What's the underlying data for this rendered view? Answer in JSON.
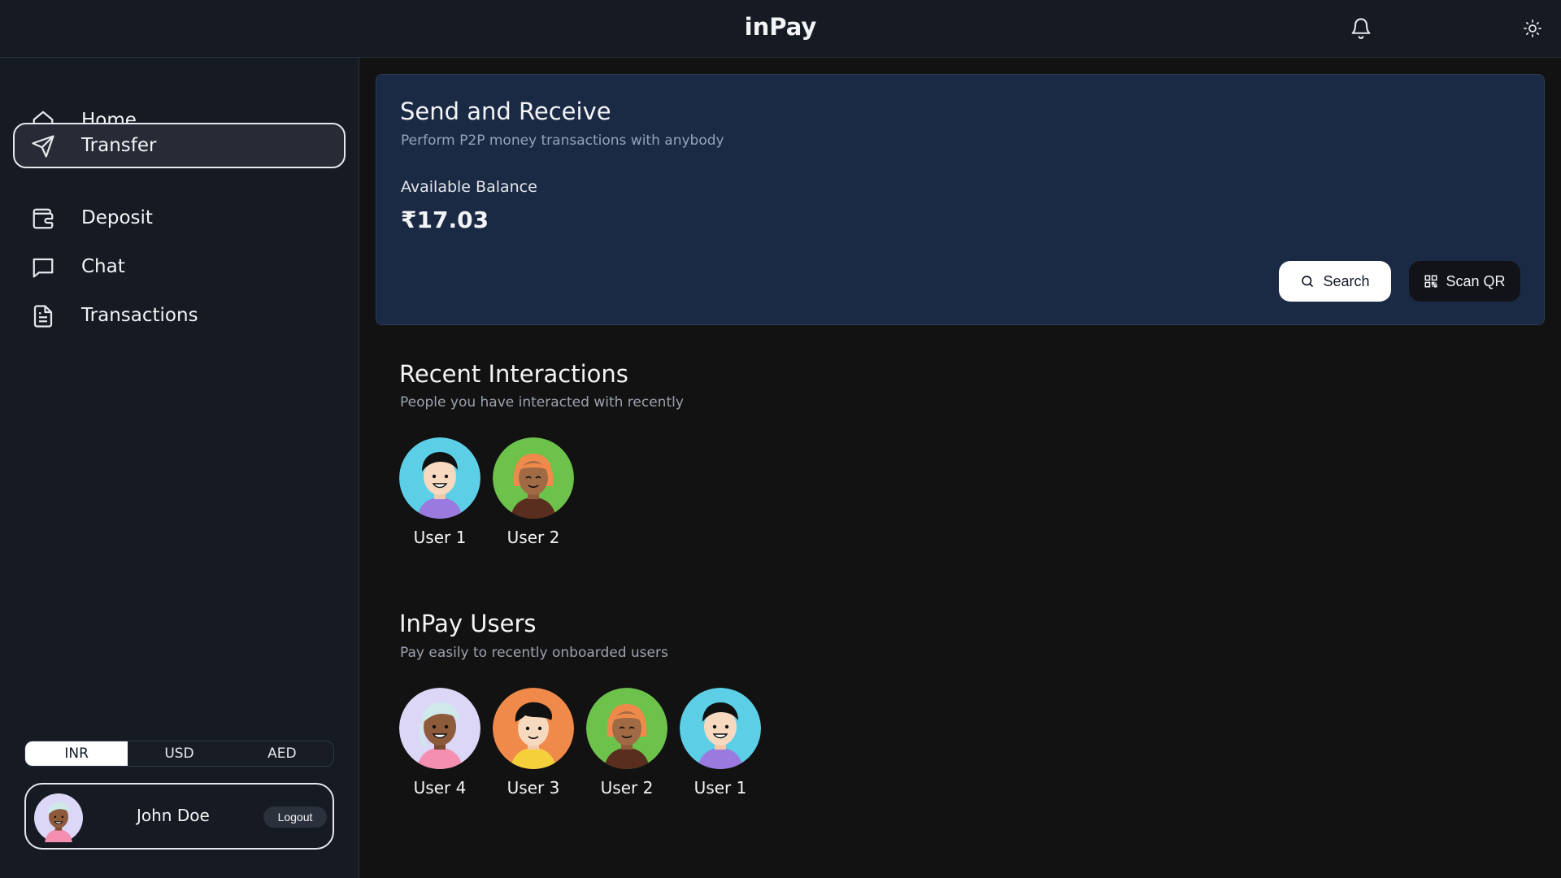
{
  "app": {
    "title": "inPay"
  },
  "header": {
    "bell_icon": "bell-icon",
    "theme_icon": "sun-icon"
  },
  "sidebar": {
    "items": [
      {
        "label": "Home",
        "icon": "home-icon",
        "active": false
      },
      {
        "label": "Transfer",
        "icon": "send-icon",
        "active": true
      },
      {
        "label": "Deposit",
        "icon": "wallet-icon",
        "active": false
      },
      {
        "label": "Chat",
        "icon": "chat-icon",
        "active": false
      },
      {
        "label": "Transactions",
        "icon": "document-icon",
        "active": false
      }
    ],
    "currencies": [
      {
        "label": "INR",
        "selected": true
      },
      {
        "label": "USD",
        "selected": false
      },
      {
        "label": "AED",
        "selected": false
      }
    ],
    "user": {
      "name": "John Doe",
      "logout_label": "Logout"
    }
  },
  "hero": {
    "title": "Send and Receive",
    "subtitle": "Perform P2P money transactions with anybody",
    "balance_label": "Available Balance",
    "balance_value": "₹17.03",
    "search_label": "Search",
    "scan_label": "Scan QR"
  },
  "recent": {
    "title": "Recent Interactions",
    "subtitle": "People you have interacted with recently",
    "users": [
      {
        "name": "User 1",
        "bg": "#5ccfe6"
      },
      {
        "name": "User 2",
        "bg": "#6cc24a"
      }
    ]
  },
  "inpay_users": {
    "title": "InPay Users",
    "subtitle": "Pay easily to recently onboarded users",
    "users": [
      {
        "name": "User 4",
        "bg": "#dcd6f7"
      },
      {
        "name": "User 3",
        "bg": "#f08a4b"
      },
      {
        "name": "User 2",
        "bg": "#6cc24a"
      },
      {
        "name": "User 1",
        "bg": "#5ccfe6"
      }
    ]
  }
}
